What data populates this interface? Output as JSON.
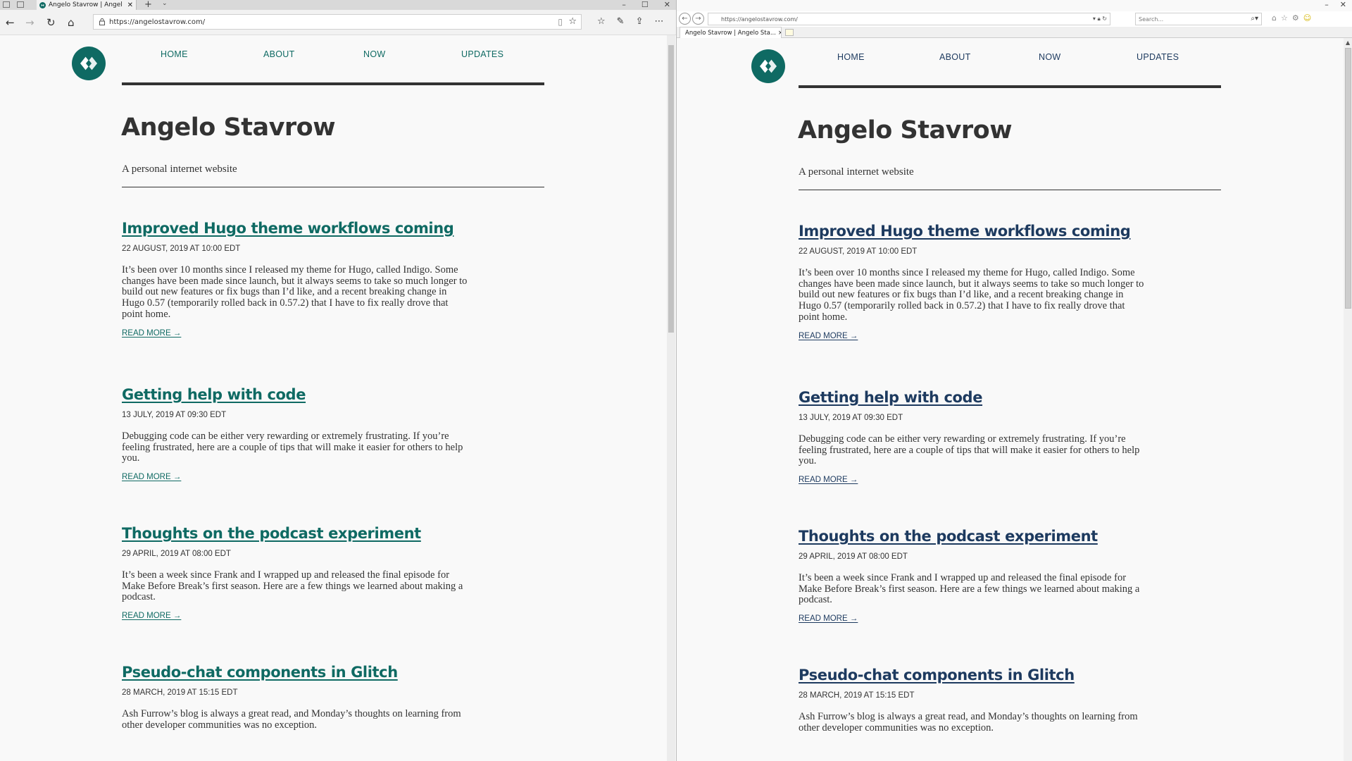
{
  "colors": {
    "accent_left": "#0f6a63",
    "accent_right": "#1d3a5f",
    "text": "#333333",
    "background": "#f9f9f9"
  },
  "left_browser": {
    "tab_title": "Angelo Stavrow | Angel",
    "address": "https://angelostavrow.com/",
    "icons": [
      "back-icon",
      "forward-icon",
      "refresh-icon",
      "home-icon",
      "lock-icon",
      "reading-view-icon",
      "favorite-star-icon",
      "favorites-hub-icon",
      "pen-icon",
      "share-icon",
      "more-icon"
    ]
  },
  "right_browser": {
    "tab_title": "Angelo Stavrow | Angelo Sta...",
    "address": "https://angelostavrow.com/",
    "search_placeholder": "Search...",
    "icons": [
      "back-icon",
      "forward-icon",
      "lock-icon",
      "refresh-icon",
      "search-icon",
      "home-icon",
      "favorites-icon",
      "gear-icon",
      "smiley-icon"
    ]
  },
  "site": {
    "nav": [
      "HOME",
      "ABOUT",
      "NOW",
      "UPDATES"
    ],
    "title": "Angelo Stavrow",
    "subtitle": "A personal internet website",
    "read_more": "READ MORE →",
    "posts": [
      {
        "title": "Improved Hugo theme workflows coming",
        "date": "22 AUGUST, 2019 AT 10:00 EDT",
        "excerpt": "It’s been over 10 months since I released my theme for Hugo, called Indigo. Some changes have been made since launch, but it always seems to take so much longer to build out new features or fix bugs than I’d like, and a recent breaking change in Hugo 0.57 (temporarily rolled back in 0.57.2) that I have to fix really drove that point home."
      },
      {
        "title": "Getting help with code",
        "date": "13 JULY, 2019 AT 09:30 EDT",
        "excerpt": "Debugging code can be either very rewarding or extremely frustrating. If you’re feeling frustrated, here are a couple of tips that will make it easier for others to help you."
      },
      {
        "title": "Thoughts on the podcast experiment",
        "date": "29 APRIL, 2019 AT 08:00 EDT",
        "excerpt": "It’s been a week since Frank and I wrapped up and released the final episode for Make Before Break’s first season. Here are a few things we learned about making a podcast."
      },
      {
        "title": "Pseudo-chat components in Glitch",
        "date": "28 MARCH, 2019 AT 15:15 EDT",
        "excerpt": "Ash Furrow’s blog is always a great read, and Monday’s thoughts on learning from other developer communities was no exception."
      }
    ]
  }
}
